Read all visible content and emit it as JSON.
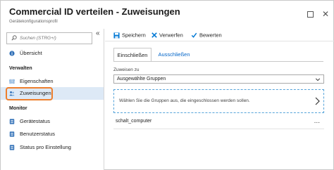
{
  "header": {
    "title": "Commercial ID verteilen - Zuweisungen",
    "subtitle": "Gerätekonfigurationsprofil"
  },
  "window": {
    "maximize_icon": "maximize-icon",
    "close_symbol": "✕"
  },
  "sidebar": {
    "search_placeholder": "Suchen (STRG+/)",
    "collapse_symbol": "«",
    "overview_label": "Übersicht",
    "section_manage": "Verwalten",
    "properties_label": "Eigenschaften",
    "assignments_label": "Zuweisungen",
    "section_monitor": "Monitor",
    "device_status_label": "Gerätestatus",
    "user_status_label": "Benutzerstatus",
    "per_setting_status_label": "Status pro Einstellung"
  },
  "toolbar": {
    "save_label": "Speichern",
    "discard_label": "Verwerfen",
    "review_label": "Bewerten"
  },
  "main": {
    "tab_include": "Einschließen",
    "tab_exclude": "Ausschließen",
    "assign_to_label": "Zuweisen zu",
    "assign_to_value": "Ausgewählte Gruppen",
    "picker_message": "Wählen Sie die Gruppen aus, die eingeschlossen werden sollen.",
    "groups": [
      {
        "name": "schalt_computer",
        "more": "..."
      }
    ]
  },
  "colors": {
    "accent": "#0078d4",
    "highlight_border": "#ee7f2d",
    "active_bg": "#dde9f6"
  }
}
